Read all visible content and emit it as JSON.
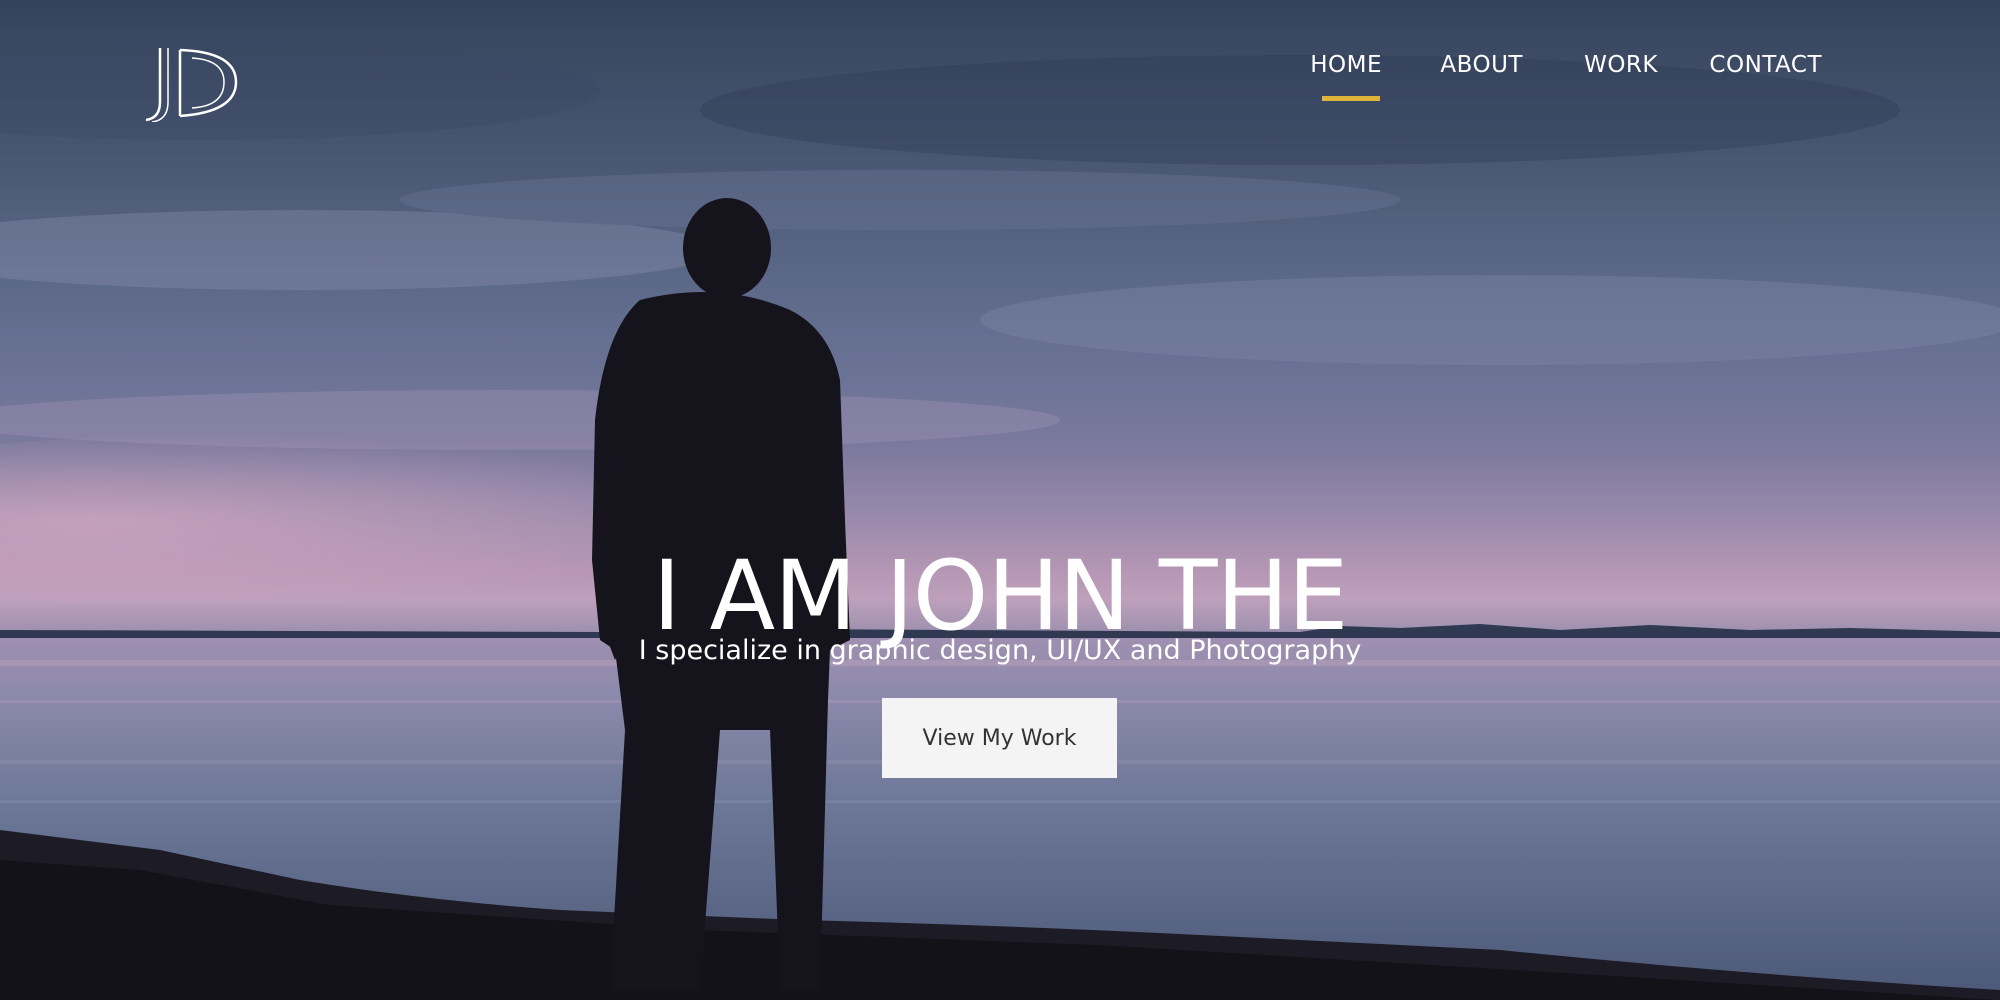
{
  "logo": {
    "text": "JD"
  },
  "nav": {
    "items": [
      {
        "label": "HOME",
        "active": true
      },
      {
        "label": "ABOUT",
        "active": false
      },
      {
        "label": "WORK",
        "active": false
      },
      {
        "label": "CONTACT",
        "active": false
      }
    ],
    "active_underline_color": "#e0b43a"
  },
  "hero": {
    "headline": "I AM JOHN THE",
    "subtitle": "I specialize in graphic design, UI/UX and Photography",
    "cta_label": "View My Work",
    "background_image": "man-standing-by-lake-at-dusk"
  }
}
